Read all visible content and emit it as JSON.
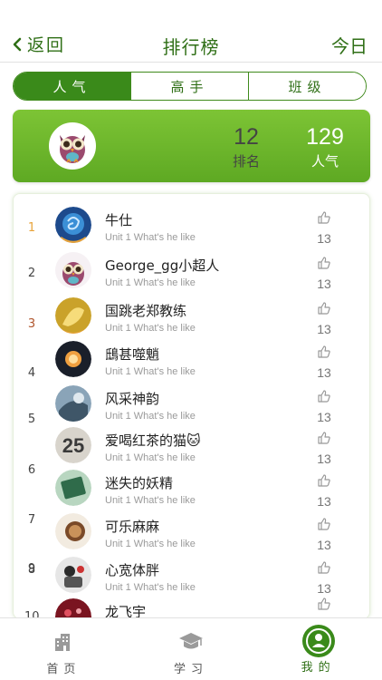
{
  "header": {
    "back_label": "返回",
    "title": "排行榜",
    "right_label": "今日"
  },
  "tabs": [
    {
      "label": "人气",
      "active": true
    },
    {
      "label": "高手",
      "active": false
    },
    {
      "label": "班级",
      "active": false
    }
  ],
  "my_card": {
    "rank_value": "12",
    "rank_label": "排名",
    "popularity_value": "129",
    "popularity_label": "人气"
  },
  "list": [
    {
      "rank": "1",
      "name": "牛仕",
      "subtitle": "Unit 1 What's he like",
      "likes": "13"
    },
    {
      "rank": "2",
      "name": "George_gg小超人",
      "subtitle": "Unit 1 What's he like",
      "likes": "13"
    },
    {
      "rank": "3",
      "name": "国跳老郑教练",
      "subtitle": "Unit 1 What's he like",
      "likes": "13"
    },
    {
      "rank": "4",
      "name": "鴟甚噬魈",
      "subtitle": "Unit 1 What's he like",
      "likes": "13"
    },
    {
      "rank": "5",
      "name": "风采神韵",
      "subtitle": "Unit 1 What's he like",
      "likes": "13"
    },
    {
      "rank": "6",
      "name": "爱喝红茶的猫🐱",
      "subtitle": "Unit 1 What's he like",
      "likes": "13"
    },
    {
      "rank": "7",
      "name": "迷失的妖精",
      "subtitle": "Unit 1 What's he like",
      "likes": "13"
    },
    {
      "rank": "8",
      "name": "可乐麻麻",
      "subtitle": "Unit 1 What's he like",
      "likes": "13"
    },
    {
      "rank": "9",
      "name": "心宽体胖",
      "subtitle": "Unit 1 What's he like",
      "likes": "13"
    },
    {
      "rank": "10",
      "name": "龙飞宇",
      "subtitle": "",
      "likes": ""
    }
  ],
  "rank_colors": {
    "gold": "#e8a33a",
    "silver": "#444444",
    "bronze": "#b0552c"
  },
  "bottom_nav": [
    {
      "label": "首页",
      "icon": "building-icon",
      "active": false
    },
    {
      "label": "学习",
      "icon": "graduation-cap-icon",
      "active": false
    },
    {
      "label": "我的",
      "icon": "user-circle-icon",
      "active": true
    }
  ],
  "colors": {
    "primary": "#3a8a1a",
    "accent": "#6fb62b",
    "text_green": "#2f6f16"
  }
}
